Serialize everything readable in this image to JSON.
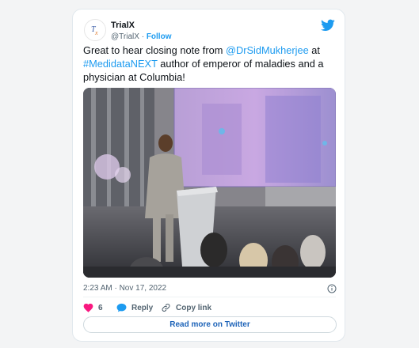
{
  "tweet": {
    "display_name": "TrialX",
    "handle": "@TrialX",
    "separator": "·",
    "follow_label": "Follow",
    "avatar_text": "Tx",
    "text_intro": "Great to hear closing note from ",
    "mention": "@DrSidMukherjee",
    "text_mid": "  at ",
    "hashtag": "#MedidataNEXT",
    "text_end": " author of emperor of maladies and a physician at Columbia!",
    "timestamp": "2:23 AM · Nov 17, 2022",
    "like_count": "6",
    "reply_label": "Reply",
    "copy_label": "Copy link",
    "read_more_label": "Read more on Twitter",
    "media_description": "Speaker at podium on stage",
    "icons": {
      "brand": "twitter-bird-icon",
      "info": "info-icon",
      "like": "heart-icon",
      "reply": "reply-bubble-icon",
      "copy": "link-icon"
    },
    "colors": {
      "accent": "#1d9bf0",
      "like": "#f91880",
      "text": "#0f1419",
      "muted": "#536471"
    }
  }
}
